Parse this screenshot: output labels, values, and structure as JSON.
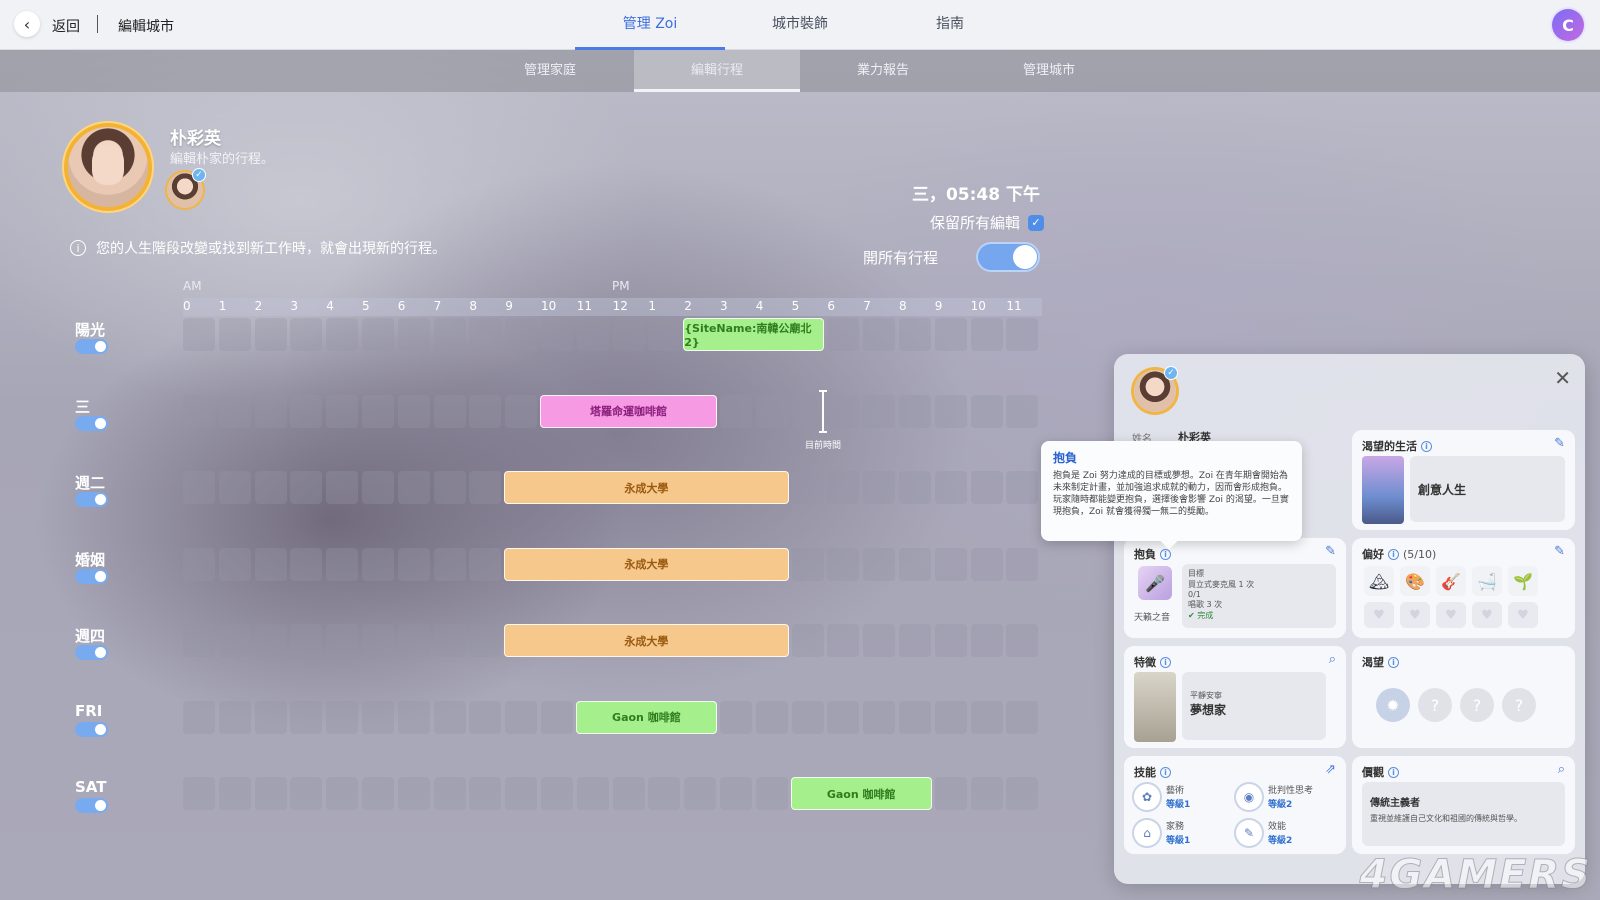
{
  "topbar": {
    "back_label": "返回",
    "title": "編輯城市",
    "tabs": [
      "管理 Zoi",
      "城市裝飾",
      "指南"
    ],
    "active_tab": "管理 Zoi"
  },
  "subbar": {
    "tabs": [
      "管理家庭",
      "編輯行程",
      "業力報告",
      "管理城市"
    ],
    "active_tab": "編輯行程"
  },
  "header": {
    "name": "朴彩英",
    "subtitle": "編輯朴家的行程。",
    "info_text": "您的人生階段改變或找到新工作時，就會出現新的行程。",
    "clock": "三，05:48 下午",
    "keep_edits_label": "保留所有編輯",
    "keep_edits_checked": true,
    "open_all_label": "開所有行程",
    "open_all_on": true
  },
  "timeline": {
    "am_label": "AM",
    "pm_label": "PM",
    "hours": [
      "0",
      "1",
      "2",
      "3",
      "4",
      "5",
      "6",
      "7",
      "8",
      "9",
      "10",
      "11",
      "12",
      "1",
      "2",
      "3",
      "4",
      "5",
      "6",
      "7",
      "8",
      "9",
      "10",
      "11"
    ],
    "now_label": "目前時間",
    "rows": [
      {
        "label": "陽光",
        "enabled": true,
        "events": [
          {
            "text": "{SiteName:南韓公廟北 2}",
            "start": 14,
            "end": 18,
            "color": "green"
          }
        ]
      },
      {
        "label": "三",
        "enabled": true,
        "events": [
          {
            "text": "塔羅命運咖啡館",
            "start": 10,
            "end": 15,
            "color": "pink"
          }
        ]
      },
      {
        "label": "週二",
        "enabled": true,
        "events": [
          {
            "text": "永成大學",
            "start": 9,
            "end": 17,
            "color": "orange"
          }
        ]
      },
      {
        "label": "婚姻",
        "enabled": true,
        "events": [
          {
            "text": "永成大學",
            "start": 9,
            "end": 17,
            "color": "orange"
          }
        ]
      },
      {
        "label": "週四",
        "enabled": true,
        "events": [
          {
            "text": "永成大學",
            "start": 9,
            "end": 17,
            "color": "orange"
          }
        ]
      },
      {
        "label": "FRI",
        "enabled": true,
        "events": [
          {
            "text": "Gaon 咖啡館",
            "start": 11,
            "end": 15,
            "color": "green"
          }
        ]
      },
      {
        "label": "SAT",
        "enabled": true,
        "events": [
          {
            "text": "Gaon 咖啡館",
            "start": 17,
            "end": 21,
            "color": "green"
          }
        ]
      }
    ]
  },
  "panel": {
    "name_label": "姓名",
    "name": "朴彩英",
    "close_icon": "close-icon",
    "desired_life": {
      "title": "渴望的生活",
      "value": "創意人生"
    },
    "aspiration": {
      "title": "抱負",
      "name": "天籟之音",
      "goal_label": "目標",
      "goal_1": "買立式麥克風 1 次",
      "goal_1_progress": "0/1",
      "goal_2": "唱歌 3 次",
      "goal_2_status": "✔ 完成"
    },
    "preferences": {
      "title": "偏好",
      "count": "(5/10)",
      "icons": [
        "🏔",
        "🎨",
        "🎸",
        "🛁",
        "🌱"
      ]
    },
    "traits": {
      "title": "特徵",
      "subtitle": "平靜安寧",
      "value": "夢想家"
    },
    "wants": {
      "title": "渴望"
    },
    "skills": {
      "title": "技能",
      "items": [
        {
          "name": "藝術",
          "level": "等級1"
        },
        {
          "name": "批判性思考",
          "level": "等級2"
        },
        {
          "name": "家務",
          "level": "等級1"
        },
        {
          "name": "效能",
          "level": "等級2"
        }
      ]
    },
    "values": {
      "title": "價觀",
      "name": "傳統主義者",
      "desc": "重視並維護自己文化和祖國的傳統與哲學。"
    }
  },
  "tooltip": {
    "title": "抱負",
    "body": "抱負是 Zoi 努力達成的目標或夢想。Zoi 在青年期會開始為未來制定計畫，並加強追求成就的動力，因而會形成抱負。玩家隨時都能變更抱負，選擇後會影響 Zoi 的渴望。一旦實現抱負，Zoi 就會獲得獨一無二的獎勵。"
  },
  "watermark": "4GAMERS",
  "colors": {
    "accent": "#4b7be8",
    "green": "#a5ef8d",
    "pink": "#f69ae4",
    "orange": "#f6c88b"
  }
}
